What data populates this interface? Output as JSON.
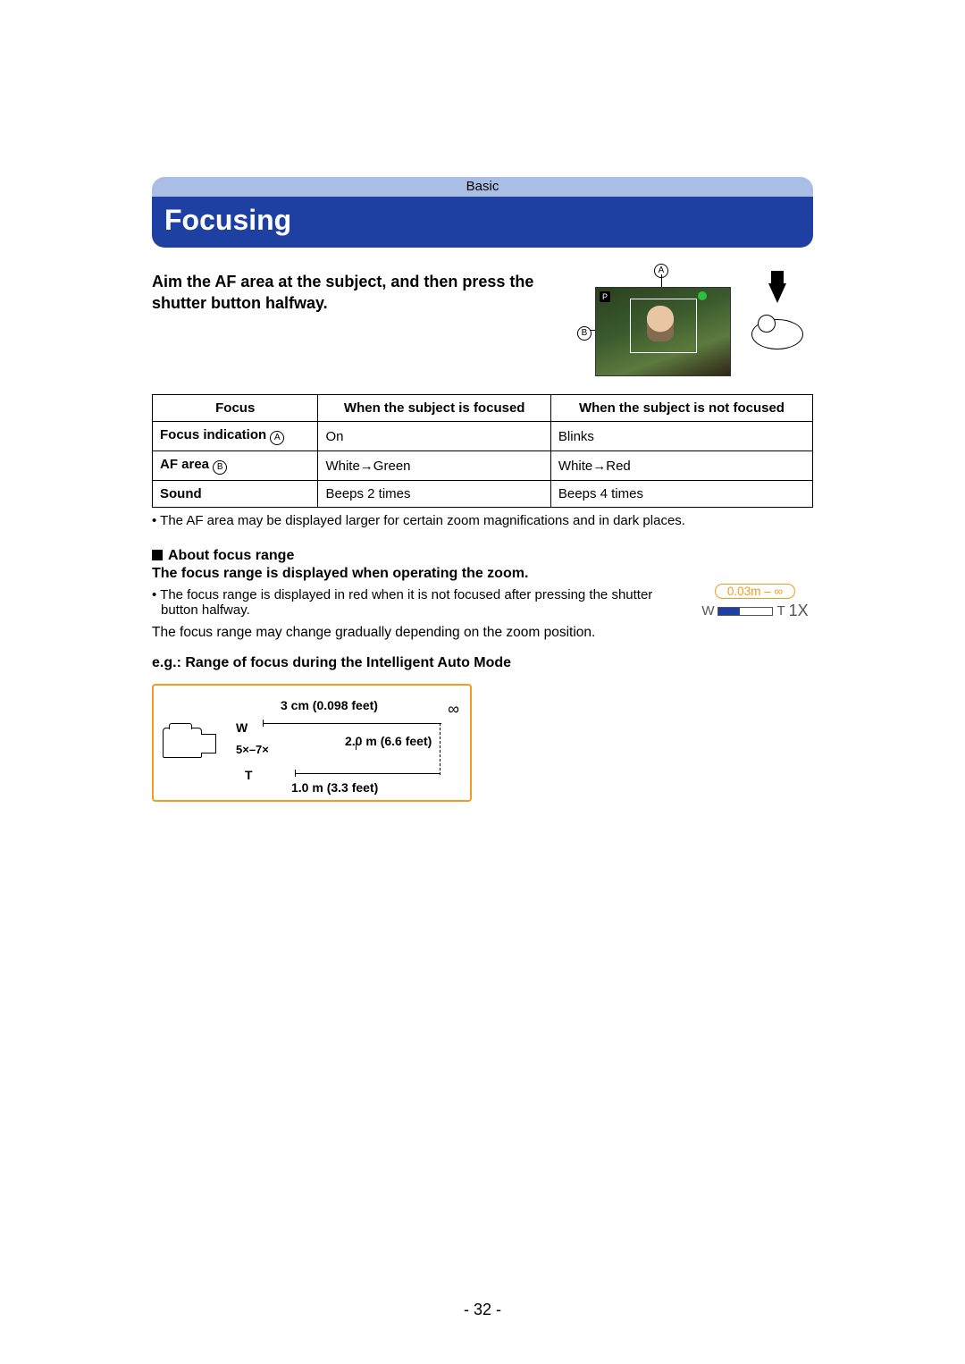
{
  "breadcrumb": "Basic",
  "heading": "Focusing",
  "intro": "Aim the AF area at the subject, and then press the shutter button halfway.",
  "markers": {
    "a": "A",
    "b": "B",
    "p": "P"
  },
  "table": {
    "headers": [
      "Focus",
      "When the subject is focused",
      "When the subject is not focused"
    ],
    "rows": [
      {
        "label": "Focus indication ",
        "mark": "A",
        "c1": "On",
        "c2": "Blinks"
      },
      {
        "label": "AF area ",
        "mark": "B",
        "c1": "White→Green",
        "c2": "White→Red"
      },
      {
        "label": "Sound",
        "mark": "",
        "c1": "Beeps 2 times",
        "c2": "Beeps 4 times"
      }
    ]
  },
  "note_af_area": "The AF area may be displayed larger for certain zoom magnifications and in dark places.",
  "section": {
    "title": "About focus range",
    "line1": "The focus range is displayed when operating the zoom.",
    "note": "The focus range is displayed in red when it is not focused after pressing the shutter button halfway.",
    "line2": "The focus range may change gradually depending on the zoom position.",
    "eg": "e.g.: Range of focus during the Intelligent Auto Mode"
  },
  "zoom_indicator": {
    "range": "0.03m – ∞",
    "w": "W",
    "t": "T",
    "mag": "1X"
  },
  "diagram": {
    "w": "W",
    "mid": "5×–7×",
    "t": "T",
    "val_w": "3 cm (0.098 feet)",
    "val_mid": "2.0 m (6.6 feet)",
    "val_t": "1.0 m (3.3 feet)",
    "inf": "∞"
  },
  "page_number": "- 32 -"
}
